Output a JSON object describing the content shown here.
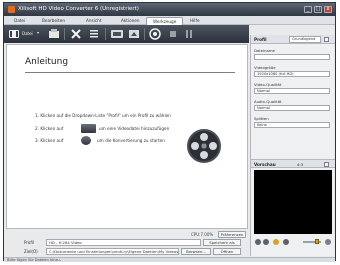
{
  "window": {
    "title": "Xilisoft HD Video Converter 6 (Unregistriert)",
    "buttons": {
      "minimize": "_",
      "maximize": "□",
      "close": "x"
    }
  },
  "menu": [
    "Datei",
    "Bearbeiten",
    "Ansicht",
    "Aktionen",
    "Werkzeuge",
    "Hilfe"
  ],
  "menu_active": "Werkzeuge",
  "toolbar": {
    "add_label": "Datei",
    "icons": [
      "add-video-icon",
      "delete-icon",
      "clip-icon",
      "convert-icon",
      "stop-icon",
      "pause-icon"
    ]
  },
  "main": {
    "heading": "Anleitung",
    "steps": [
      {
        "num": "1.",
        "text": "Klicken auf die Dropdown-Liste \"Profil\" um ein Profil zu wählen"
      },
      {
        "num": "2.",
        "pre": "Klicken auf",
        "post": "um eine Videodatei hinzuzufügen"
      },
      {
        "num": "3.",
        "pre": "Klicken auf",
        "post": "um die Konvertierung zu starten"
      }
    ]
  },
  "status": {
    "cpu": "CPU:7.00%",
    "preferences": "Präferenzen"
  },
  "profile": {
    "label": "Profil",
    "value": "HD - H.264 Video",
    "save_as": "Speichern als"
  },
  "destination": {
    "label": "Ziel(O)",
    "value": "C:\\Dokumente und Einstellungen\\ventLry\\Eigene Dateien\\My Videos",
    "browse": "Browsen...",
    "open": "Öffnen"
  },
  "statusbar": "Bitte fügen Sie Dateien hinzu.",
  "right_panel": {
    "title": "Profil",
    "combo": "Grundlegend",
    "fields": [
      {
        "label": "Dateiname",
        "value": ""
      },
      {
        "label": "Videogröße",
        "value": "1920x1080 (full HD)"
      },
      {
        "label": "Video-Qualität",
        "value": "Normal"
      },
      {
        "label": "Audio-Qualität",
        "value": "Normal"
      },
      {
        "label": "Splitten",
        "value": "Keine"
      }
    ]
  },
  "preview": {
    "title": "Vorschau",
    "ratio": "4:3"
  },
  "colors": {
    "titlebar": "#2f3742",
    "toolbar": "#2b323b",
    "panel": "#e9eaec"
  }
}
